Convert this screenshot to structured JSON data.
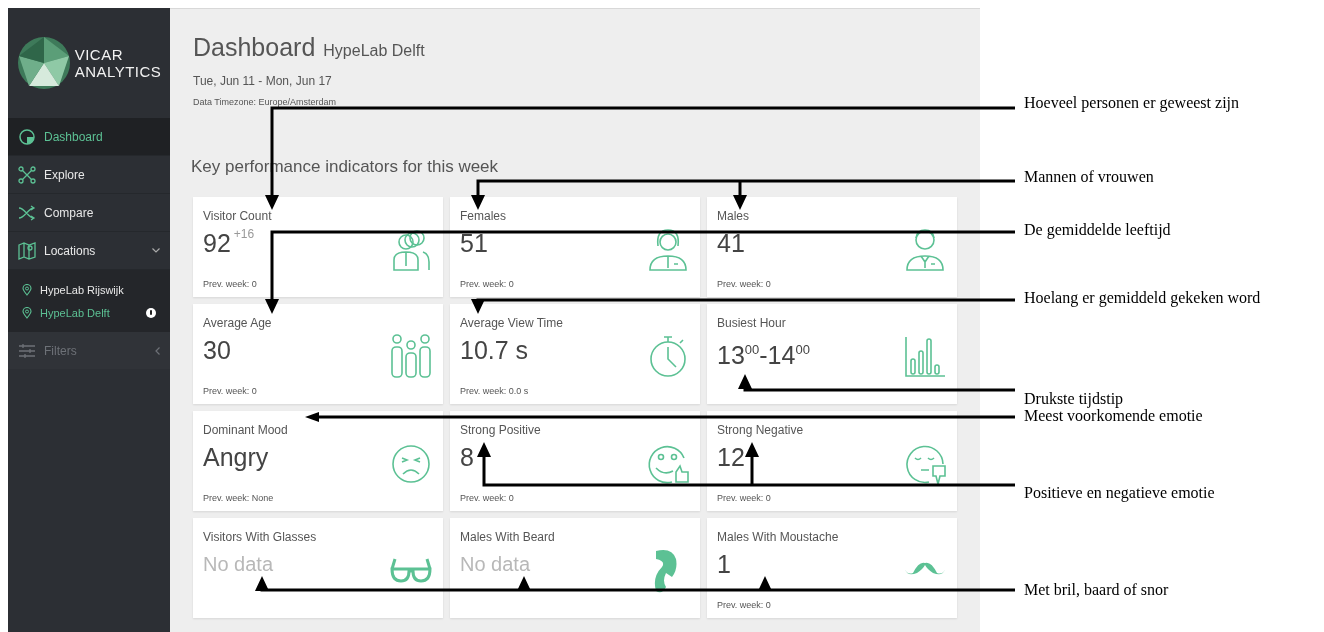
{
  "sidebar": {
    "logo": [
      "VICAR",
      "ANALYTICS"
    ],
    "nav": [
      {
        "label": "Dashboard",
        "selected": true,
        "expanded": false
      },
      {
        "label": "Explore",
        "selected": false,
        "expanded": false
      },
      {
        "label": "Compare",
        "selected": false,
        "expanded": false
      },
      {
        "label": "Locations",
        "selected": false,
        "expanded": true
      }
    ],
    "locations": [
      {
        "label": "HypeLab Rijswijk",
        "selected": false,
        "alert": false
      },
      {
        "label": "HypeLab Delft",
        "selected": true,
        "alert": true
      }
    ],
    "filters": {
      "label": "Filters",
      "disabled": true
    }
  },
  "header": {
    "title": "Dashboard",
    "subtitle": "HypeLab Delft",
    "date_range": "Tue, Jun 11 - Mon, Jun 17",
    "timezone": "Data Timezone: Europe/Amsterdam"
  },
  "section_title": "Key performance indicators for this week",
  "cards": [
    {
      "title": "Visitor Count",
      "value": "92",
      "delta": "+16",
      "prev": "Prev. week: 0",
      "muted": false
    },
    {
      "title": "Females",
      "value": "51",
      "prev": "Prev. week: 0",
      "muted": false
    },
    {
      "title": "Males",
      "value": "41",
      "prev": "Prev. week: 0",
      "muted": false
    },
    {
      "title": "Average Age",
      "value": "30",
      "prev": "Prev. week: 0",
      "muted": false
    },
    {
      "title": "Average View Time",
      "value": "10.7 s",
      "prev": "Prev. week: 0.0 s",
      "muted": false
    },
    {
      "title": "Busiest Hour",
      "value": "13$^{00}$-14$^{00}$",
      "muted": false
    },
    {
      "title": "Dominant Mood",
      "value": "Angry",
      "prev": "Prev. week: None",
      "muted": false
    },
    {
      "title": "Strong Positive",
      "value": "8",
      "prev": "Prev. week: 0",
      "muted": false
    },
    {
      "title": "Strong Negative",
      "value": "12",
      "prev": "Prev. week: 0",
      "muted": false
    },
    {
      "title": "Visitors With Glasses",
      "value": "No data",
      "muted": true
    },
    {
      "title": "Males With Beard",
      "value": "No data",
      "muted": true
    },
    {
      "title": "Males With Moustache",
      "value": "1",
      "prev": "Prev. week: 0",
      "muted": false
    }
  ],
  "annotations": [
    {
      "text": "Hoeveel personen er geweest zijn"
    },
    {
      "text": "Mannen of vrouwen"
    },
    {
      "text": "De gemiddelde leeftijd"
    },
    {
      "text": "Hoelang er gemiddeld gekeken word"
    },
    {
      "text": "Drukste tijdstip"
    },
    {
      "text": "Meest voorkomende emotie"
    },
    {
      "text": "Positieve en negatieve emotie"
    },
    {
      "text": "Met bril, baard of snor"
    }
  ]
}
